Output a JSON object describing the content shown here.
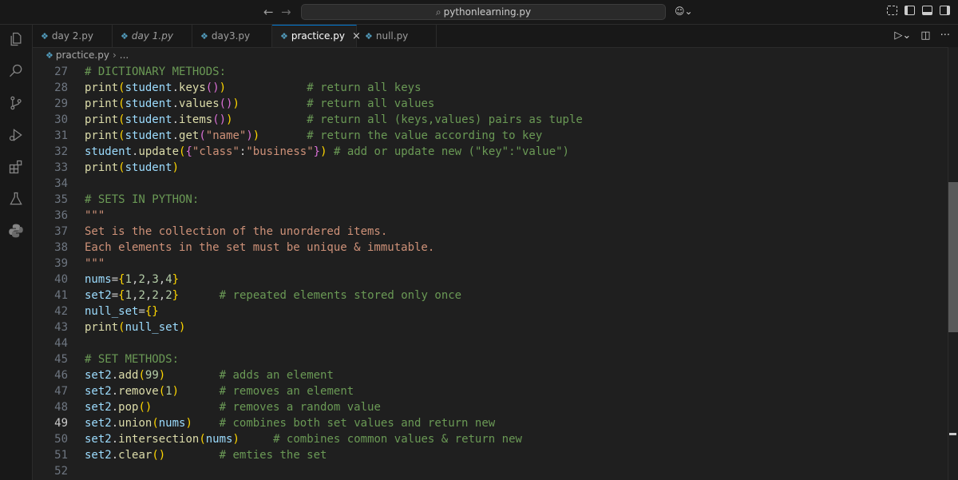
{
  "window": {
    "search_text": "pythonlearning.py"
  },
  "activity_bar": [
    "explorer-icon",
    "search-icon",
    "source-control-icon",
    "run-debug-icon",
    "extensions-icon",
    "testing-icon",
    "python-icon"
  ],
  "tabs": [
    {
      "label": "day 2.py",
      "active": false,
      "italic": false
    },
    {
      "label": "day 1.py",
      "active": false,
      "italic": true
    },
    {
      "label": "day3.py",
      "active": false,
      "italic": false
    },
    {
      "label": "practice.py",
      "active": true,
      "italic": false
    },
    {
      "label": "null.py",
      "active": false,
      "italic": false
    }
  ],
  "breadcrumb": {
    "file": "practice.py",
    "more": "..."
  },
  "editor": {
    "current_line": 49,
    "lines": [
      {
        "n": "27",
        "tokens": [
          [
            "t-com",
            "# DICTIONARY METHODS:"
          ]
        ]
      },
      {
        "n": "28",
        "tokens": [
          [
            "t-fn",
            "print"
          ],
          [
            "t-b1",
            "("
          ],
          [
            "t-var",
            "student"
          ],
          [
            "t-plain",
            "."
          ],
          [
            "t-fn",
            "keys"
          ],
          [
            "t-b2",
            "()"
          ],
          [
            "t-b1",
            ")"
          ],
          [
            "t-plain",
            "            "
          ],
          [
            "t-com",
            "# return all keys"
          ]
        ]
      },
      {
        "n": "29",
        "tokens": [
          [
            "t-fn",
            "print"
          ],
          [
            "t-b1",
            "("
          ],
          [
            "t-var",
            "student"
          ],
          [
            "t-plain",
            "."
          ],
          [
            "t-fn",
            "values"
          ],
          [
            "t-b2",
            "()"
          ],
          [
            "t-b1",
            ")"
          ],
          [
            "t-plain",
            "          "
          ],
          [
            "t-com",
            "# return all values"
          ]
        ]
      },
      {
        "n": "30",
        "tokens": [
          [
            "t-fn",
            "print"
          ],
          [
            "t-b1",
            "("
          ],
          [
            "t-var",
            "student"
          ],
          [
            "t-plain",
            "."
          ],
          [
            "t-fn",
            "items"
          ],
          [
            "t-b2",
            "()"
          ],
          [
            "t-b1",
            ")"
          ],
          [
            "t-plain",
            "           "
          ],
          [
            "t-com",
            "# return all (keys,values) pairs as tuple"
          ]
        ]
      },
      {
        "n": "31",
        "tokens": [
          [
            "t-fn",
            "print"
          ],
          [
            "t-b1",
            "("
          ],
          [
            "t-var",
            "student"
          ],
          [
            "t-plain",
            "."
          ],
          [
            "t-fn",
            "get"
          ],
          [
            "t-b2",
            "("
          ],
          [
            "t-str",
            "\"name\""
          ],
          [
            "t-b2",
            ")"
          ],
          [
            "t-b1",
            ")"
          ],
          [
            "t-plain",
            "       "
          ],
          [
            "t-com",
            "# return the value according to key"
          ]
        ]
      },
      {
        "n": "32",
        "tokens": [
          [
            "t-var",
            "student"
          ],
          [
            "t-plain",
            "."
          ],
          [
            "t-fn",
            "update"
          ],
          [
            "t-b1",
            "("
          ],
          [
            "t-b2",
            "{"
          ],
          [
            "t-str",
            "\"class\""
          ],
          [
            "t-plain",
            ":"
          ],
          [
            "t-str",
            "\"business\""
          ],
          [
            "t-b2",
            "}"
          ],
          [
            "t-b1",
            ")"
          ],
          [
            "t-plain",
            " "
          ],
          [
            "t-com",
            "# add or update new (\"key\":\"value\")"
          ]
        ]
      },
      {
        "n": "33",
        "tokens": [
          [
            "t-fn",
            "print"
          ],
          [
            "t-b1",
            "("
          ],
          [
            "t-var",
            "student"
          ],
          [
            "t-b1",
            ")"
          ]
        ]
      },
      {
        "n": "34",
        "tokens": []
      },
      {
        "n": "35",
        "tokens": [
          [
            "t-com",
            "# SETS IN PYTHON:"
          ]
        ]
      },
      {
        "n": "36",
        "tokens": [
          [
            "t-str",
            "\"\"\""
          ]
        ]
      },
      {
        "n": "37",
        "tokens": [
          [
            "t-str",
            "Set is the collection of the unordered items."
          ]
        ]
      },
      {
        "n": "38",
        "tokens": [
          [
            "t-str",
            "Each elements in the set must be unique & immutable."
          ]
        ]
      },
      {
        "n": "39",
        "tokens": [
          [
            "t-str",
            "\"\"\""
          ]
        ]
      },
      {
        "n": "40",
        "tokens": [
          [
            "t-var",
            "nums"
          ],
          [
            "t-plain",
            "="
          ],
          [
            "t-b1",
            "{"
          ],
          [
            "t-num",
            "1"
          ],
          [
            "t-plain",
            ","
          ],
          [
            "t-num",
            "2"
          ],
          [
            "t-plain",
            ","
          ],
          [
            "t-num",
            "3"
          ],
          [
            "t-plain",
            ","
          ],
          [
            "t-num",
            "4"
          ],
          [
            "t-b1",
            "}"
          ]
        ]
      },
      {
        "n": "41",
        "tokens": [
          [
            "t-var",
            "set2"
          ],
          [
            "t-plain",
            "="
          ],
          [
            "t-b1",
            "{"
          ],
          [
            "t-num",
            "1"
          ],
          [
            "t-plain",
            ","
          ],
          [
            "t-num",
            "2"
          ],
          [
            "t-plain",
            ","
          ],
          [
            "t-num",
            "2"
          ],
          [
            "t-plain",
            ","
          ],
          [
            "t-num",
            "2"
          ],
          [
            "t-b1",
            "}"
          ],
          [
            "t-plain",
            "      "
          ],
          [
            "t-com",
            "# repeated elements stored only once"
          ]
        ]
      },
      {
        "n": "42",
        "tokens": [
          [
            "t-var",
            "null_set"
          ],
          [
            "t-plain",
            "="
          ],
          [
            "t-b1",
            "{}"
          ]
        ]
      },
      {
        "n": "43",
        "tokens": [
          [
            "t-fn",
            "print"
          ],
          [
            "t-b1",
            "("
          ],
          [
            "t-var",
            "null_set"
          ],
          [
            "t-b1",
            ")"
          ]
        ]
      },
      {
        "n": "44",
        "tokens": []
      },
      {
        "n": "45",
        "tokens": [
          [
            "t-com",
            "# SET METHODS:"
          ]
        ]
      },
      {
        "n": "46",
        "tokens": [
          [
            "t-var",
            "set2"
          ],
          [
            "t-plain",
            "."
          ],
          [
            "t-fn",
            "add"
          ],
          [
            "t-b1",
            "("
          ],
          [
            "t-num",
            "99"
          ],
          [
            "t-b1",
            ")"
          ],
          [
            "t-plain",
            "        "
          ],
          [
            "t-com",
            "# adds an element"
          ]
        ]
      },
      {
        "n": "47",
        "tokens": [
          [
            "t-var",
            "set2"
          ],
          [
            "t-plain",
            "."
          ],
          [
            "t-fn",
            "remove"
          ],
          [
            "t-b1",
            "("
          ],
          [
            "t-num",
            "1"
          ],
          [
            "t-b1",
            ")"
          ],
          [
            "t-plain",
            "      "
          ],
          [
            "t-com",
            "# removes an element"
          ]
        ]
      },
      {
        "n": "48",
        "tokens": [
          [
            "t-var",
            "set2"
          ],
          [
            "t-plain",
            "."
          ],
          [
            "t-fn",
            "pop"
          ],
          [
            "t-b1",
            "()"
          ],
          [
            "t-plain",
            "          "
          ],
          [
            "t-com",
            "# removes a random value"
          ]
        ]
      },
      {
        "n": "49",
        "tokens": [
          [
            "t-var",
            "set2"
          ],
          [
            "t-plain",
            "."
          ],
          [
            "t-fn",
            "union"
          ],
          [
            "t-b1",
            "("
          ],
          [
            "t-var",
            "nums"
          ],
          [
            "t-b1",
            ")"
          ],
          [
            "t-plain",
            "    "
          ],
          [
            "t-com",
            "# combines both set values and return new"
          ]
        ]
      },
      {
        "n": "50",
        "tokens": [
          [
            "t-var",
            "set2"
          ],
          [
            "t-plain",
            "."
          ],
          [
            "t-fn",
            "intersection"
          ],
          [
            "t-b1",
            "("
          ],
          [
            "t-var",
            "nums"
          ],
          [
            "t-b1",
            ")"
          ],
          [
            "t-plain",
            "     "
          ],
          [
            "t-com",
            "# combines common values & return new"
          ]
        ]
      },
      {
        "n": "51",
        "tokens": [
          [
            "t-var",
            "set2"
          ],
          [
            "t-plain",
            "."
          ],
          [
            "t-fn",
            "clear"
          ],
          [
            "t-b1",
            "()"
          ],
          [
            "t-plain",
            "        "
          ],
          [
            "t-com",
            "# emties the set"
          ]
        ]
      },
      {
        "n": "52",
        "tokens": []
      }
    ]
  }
}
